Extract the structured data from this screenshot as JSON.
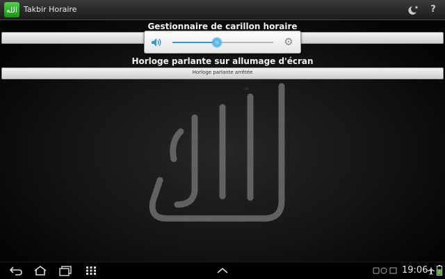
{
  "app": {
    "title": "Takbir Horaire",
    "icon_glyph": "الله"
  },
  "actionbar": {
    "icons": [
      "moon-star-icon",
      "help-icon"
    ]
  },
  "main": {
    "section1_title": "Gestionnaire de carillon horaire",
    "section2_title": "Horloge parlante sur allumage d'écran",
    "bar2_text": "Horloge parlante arrêtée"
  },
  "volume_popup": {
    "level": 0.44,
    "accent_color": "#2f9bd6",
    "icons": [
      "speaker-icon",
      "settings-gear-icon"
    ]
  },
  "background": {
    "calligraphy": "الله"
  },
  "navbar": {
    "buttons": [
      "back-icon",
      "home-icon",
      "recent-apps-icon",
      "apps-grid-icon",
      "chevron-up-icon"
    ]
  },
  "status": {
    "time": "19:06"
  }
}
